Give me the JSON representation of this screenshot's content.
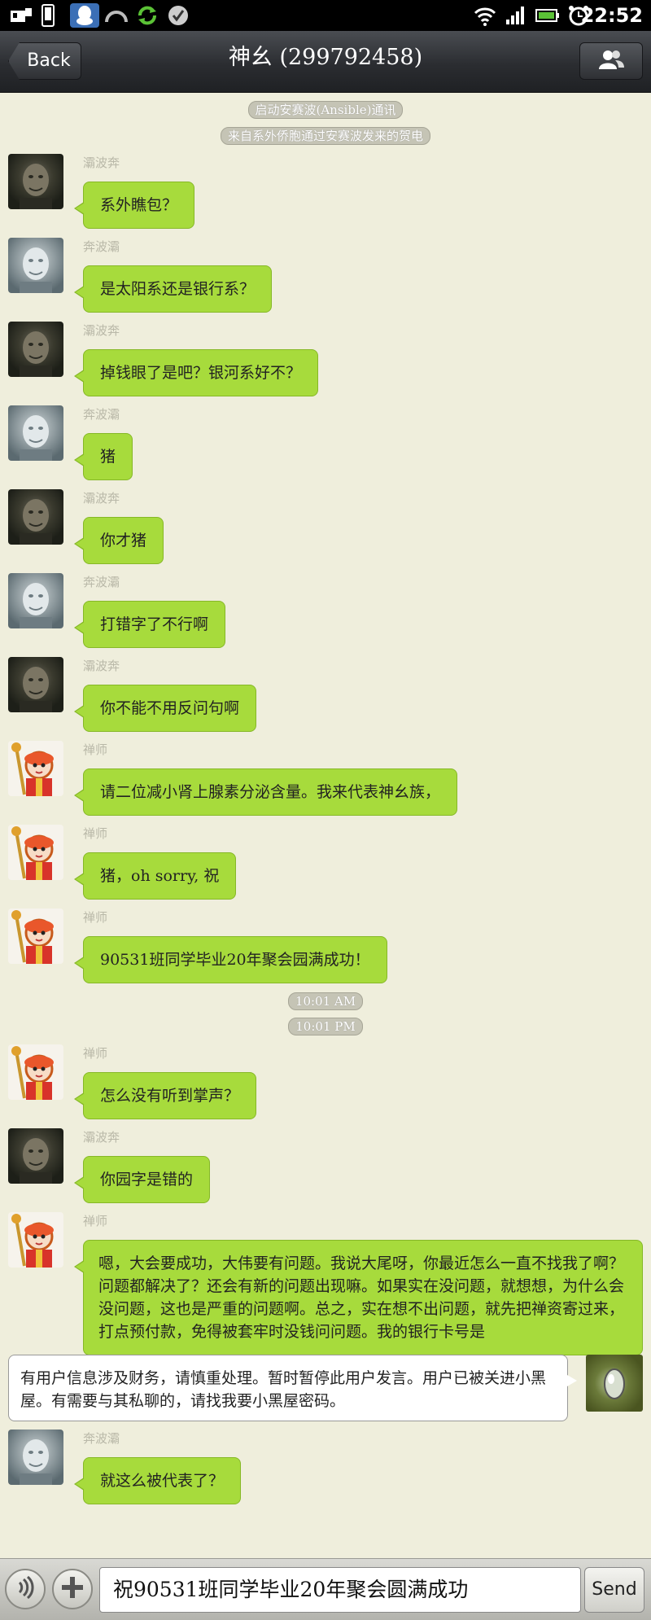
{
  "status_bar": {
    "time": "22:52"
  },
  "header": {
    "back_label": "Back",
    "title": "神幺 (299792458)"
  },
  "notices": [
    "启动安赛波(Ansible)通讯",
    "来自系外侨胞通过安赛波发来的贺电"
  ],
  "messages": [
    {
      "sender": "灞波奔",
      "avatar": "dark",
      "text": "系外瞧包？"
    },
    {
      "sender": "奔波灞",
      "avatar": "grey",
      "text": "是太阳系还是银行系？"
    },
    {
      "sender": "灞波奔",
      "avatar": "dark",
      "text": "掉钱眼了是吧？银河系好不？"
    },
    {
      "sender": "奔波灞",
      "avatar": "grey",
      "text": "猪"
    },
    {
      "sender": "灞波奔",
      "avatar": "dark",
      "text": "你才猪"
    },
    {
      "sender": "奔波灞",
      "avatar": "grey",
      "text": "打错字了不行啊"
    },
    {
      "sender": "灞波奔",
      "avatar": "dark",
      "text": "你不能不用反问句啊"
    },
    {
      "sender": "禅师",
      "avatar": "monk",
      "text": "请二位减小肾上腺素分泌含量。我来代表神幺族，"
    },
    {
      "sender": "禅师",
      "avatar": "monk",
      "text": "猪，oh sorry, 祝"
    },
    {
      "sender": "禅师",
      "avatar": "monk",
      "text": "90531班同学毕业20年聚会园满成功！"
    },
    {
      "sender": "禅师",
      "avatar": "monk",
      "text": "怎么没有听到掌声？"
    },
    {
      "sender": "灞波奔",
      "avatar": "dark",
      "text": "你园字是错的"
    },
    {
      "sender": "禅师",
      "avatar": "monk",
      "text": "嗯，大会要成功，大伟要有问题。我说大尾呀，你最近怎么一直不找我了啊？问题都解决了？还会有新的问题出现嘛。如果实在没问题，就想想，为什么会没问题，这也是严重的问题啊。总之，实在想不出问题，就先把禅资寄过来，打点预付款，免得被套牢时没钱问问题。我的银行卡号是"
    },
    {
      "sender": "奔波灞",
      "avatar": "grey",
      "text": "就这么被代表了？"
    }
  ],
  "timestamps": [
    "10:01 AM",
    "10:01 PM"
  ],
  "self_message": "有用户信息涉及财务，请慎重处理。暂时暂停此用户发言。用户已被关进小黑屋。有需要与其私聊的，请找我要小黑屋密码。",
  "input": {
    "value": "祝90531班同学毕业20年聚会圆满成功",
    "send_label": "Send"
  }
}
